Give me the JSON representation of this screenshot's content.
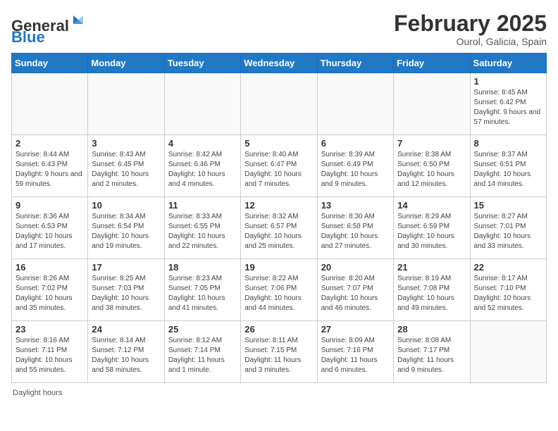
{
  "logo": {
    "general": "General",
    "blue": "Blue"
  },
  "header": {
    "title": "February 2025",
    "subtitle": "Ourol, Galicia, Spain"
  },
  "days_of_week": [
    "Sunday",
    "Monday",
    "Tuesday",
    "Wednesday",
    "Thursday",
    "Friday",
    "Saturday"
  ],
  "weeks": [
    [
      {
        "day": "",
        "info": ""
      },
      {
        "day": "",
        "info": ""
      },
      {
        "day": "",
        "info": ""
      },
      {
        "day": "",
        "info": ""
      },
      {
        "day": "",
        "info": ""
      },
      {
        "day": "",
        "info": ""
      },
      {
        "day": "1",
        "info": "Sunrise: 8:45 AM\nSunset: 6:42 PM\nDaylight: 9 hours and 57 minutes."
      }
    ],
    [
      {
        "day": "2",
        "info": "Sunrise: 8:44 AM\nSunset: 6:43 PM\nDaylight: 9 hours and 59 minutes."
      },
      {
        "day": "3",
        "info": "Sunrise: 8:43 AM\nSunset: 6:45 PM\nDaylight: 10 hours and 2 minutes."
      },
      {
        "day": "4",
        "info": "Sunrise: 8:42 AM\nSunset: 6:46 PM\nDaylight: 10 hours and 4 minutes."
      },
      {
        "day": "5",
        "info": "Sunrise: 8:40 AM\nSunset: 6:47 PM\nDaylight: 10 hours and 7 minutes."
      },
      {
        "day": "6",
        "info": "Sunrise: 8:39 AM\nSunset: 6:49 PM\nDaylight: 10 hours and 9 minutes."
      },
      {
        "day": "7",
        "info": "Sunrise: 8:38 AM\nSunset: 6:50 PM\nDaylight: 10 hours and 12 minutes."
      },
      {
        "day": "8",
        "info": "Sunrise: 8:37 AM\nSunset: 6:51 PM\nDaylight: 10 hours and 14 minutes."
      }
    ],
    [
      {
        "day": "9",
        "info": "Sunrise: 8:36 AM\nSunset: 6:53 PM\nDaylight: 10 hours and 17 minutes."
      },
      {
        "day": "10",
        "info": "Sunrise: 8:34 AM\nSunset: 6:54 PM\nDaylight: 10 hours and 19 minutes."
      },
      {
        "day": "11",
        "info": "Sunrise: 8:33 AM\nSunset: 6:55 PM\nDaylight: 10 hours and 22 minutes."
      },
      {
        "day": "12",
        "info": "Sunrise: 8:32 AM\nSunset: 6:57 PM\nDaylight: 10 hours and 25 minutes."
      },
      {
        "day": "13",
        "info": "Sunrise: 8:30 AM\nSunset: 6:58 PM\nDaylight: 10 hours and 27 minutes."
      },
      {
        "day": "14",
        "info": "Sunrise: 8:29 AM\nSunset: 6:59 PM\nDaylight: 10 hours and 30 minutes."
      },
      {
        "day": "15",
        "info": "Sunrise: 8:27 AM\nSunset: 7:01 PM\nDaylight: 10 hours and 33 minutes."
      }
    ],
    [
      {
        "day": "16",
        "info": "Sunrise: 8:26 AM\nSunset: 7:02 PM\nDaylight: 10 hours and 35 minutes."
      },
      {
        "day": "17",
        "info": "Sunrise: 8:25 AM\nSunset: 7:03 PM\nDaylight: 10 hours and 38 minutes."
      },
      {
        "day": "18",
        "info": "Sunrise: 8:23 AM\nSunset: 7:05 PM\nDaylight: 10 hours and 41 minutes."
      },
      {
        "day": "19",
        "info": "Sunrise: 8:22 AM\nSunset: 7:06 PM\nDaylight: 10 hours and 44 minutes."
      },
      {
        "day": "20",
        "info": "Sunrise: 8:20 AM\nSunset: 7:07 PM\nDaylight: 10 hours and 46 minutes."
      },
      {
        "day": "21",
        "info": "Sunrise: 8:19 AM\nSunset: 7:08 PM\nDaylight: 10 hours and 49 minutes."
      },
      {
        "day": "22",
        "info": "Sunrise: 8:17 AM\nSunset: 7:10 PM\nDaylight: 10 hours and 52 minutes."
      }
    ],
    [
      {
        "day": "23",
        "info": "Sunrise: 8:16 AM\nSunset: 7:11 PM\nDaylight: 10 hours and 55 minutes."
      },
      {
        "day": "24",
        "info": "Sunrise: 8:14 AM\nSunset: 7:12 PM\nDaylight: 10 hours and 58 minutes."
      },
      {
        "day": "25",
        "info": "Sunrise: 8:12 AM\nSunset: 7:14 PM\nDaylight: 11 hours and 1 minute."
      },
      {
        "day": "26",
        "info": "Sunrise: 8:11 AM\nSunset: 7:15 PM\nDaylight: 11 hours and 3 minutes."
      },
      {
        "day": "27",
        "info": "Sunrise: 8:09 AM\nSunset: 7:16 PM\nDaylight: 11 hours and 6 minutes."
      },
      {
        "day": "28",
        "info": "Sunrise: 8:08 AM\nSunset: 7:17 PM\nDaylight: 11 hours and 9 minutes."
      },
      {
        "day": "",
        "info": ""
      }
    ]
  ],
  "footer": {
    "daylight_label": "Daylight hours"
  }
}
